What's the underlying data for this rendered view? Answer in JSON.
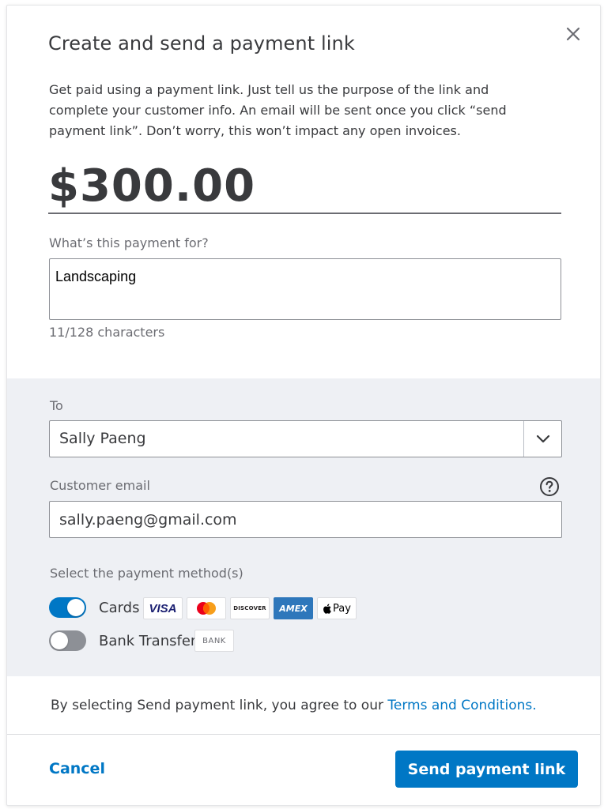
{
  "dialog": {
    "title": "Create and send a payment link",
    "intro_line1": "Get paid using a payment link. Just tell us the purpose of the link and",
    "intro_line2": "complete your customer info. An email will be sent once you click “send",
    "intro_line3": "payment link”. Don’t worry, this won’t impact any open invoices."
  },
  "amount": "$300.00",
  "purpose": {
    "label": "What’s this payment for?",
    "value": "Landscaping",
    "char_count": "11/128 characters"
  },
  "recipient": {
    "to_label": "To",
    "to_value": "Sally Paeng",
    "email_label": "Customer email",
    "email_value": "sally.paeng@gmail.com"
  },
  "payment_methods": {
    "label": "Select the payment method(s)",
    "cards": {
      "label": "Cards",
      "enabled": true,
      "badges": [
        "VISA",
        "Mastercard",
        "DISCOVER",
        "AMEX",
        "Apple Pay"
      ]
    },
    "bank": {
      "label": "Bank Transfer",
      "enabled": false,
      "badge": "BANK"
    }
  },
  "agreement": {
    "text": "By selecting Send payment link, you agree to our ",
    "link": "Terms and Conditions."
  },
  "footer": {
    "cancel_label": "Cancel",
    "send_label": "Send payment link"
  },
  "apple_pay_text": "Pay",
  "colors": {
    "accent": "#0077c5",
    "section_bg": "#eef0f4",
    "text": "#393a3d",
    "muted": "#6b6c72"
  }
}
